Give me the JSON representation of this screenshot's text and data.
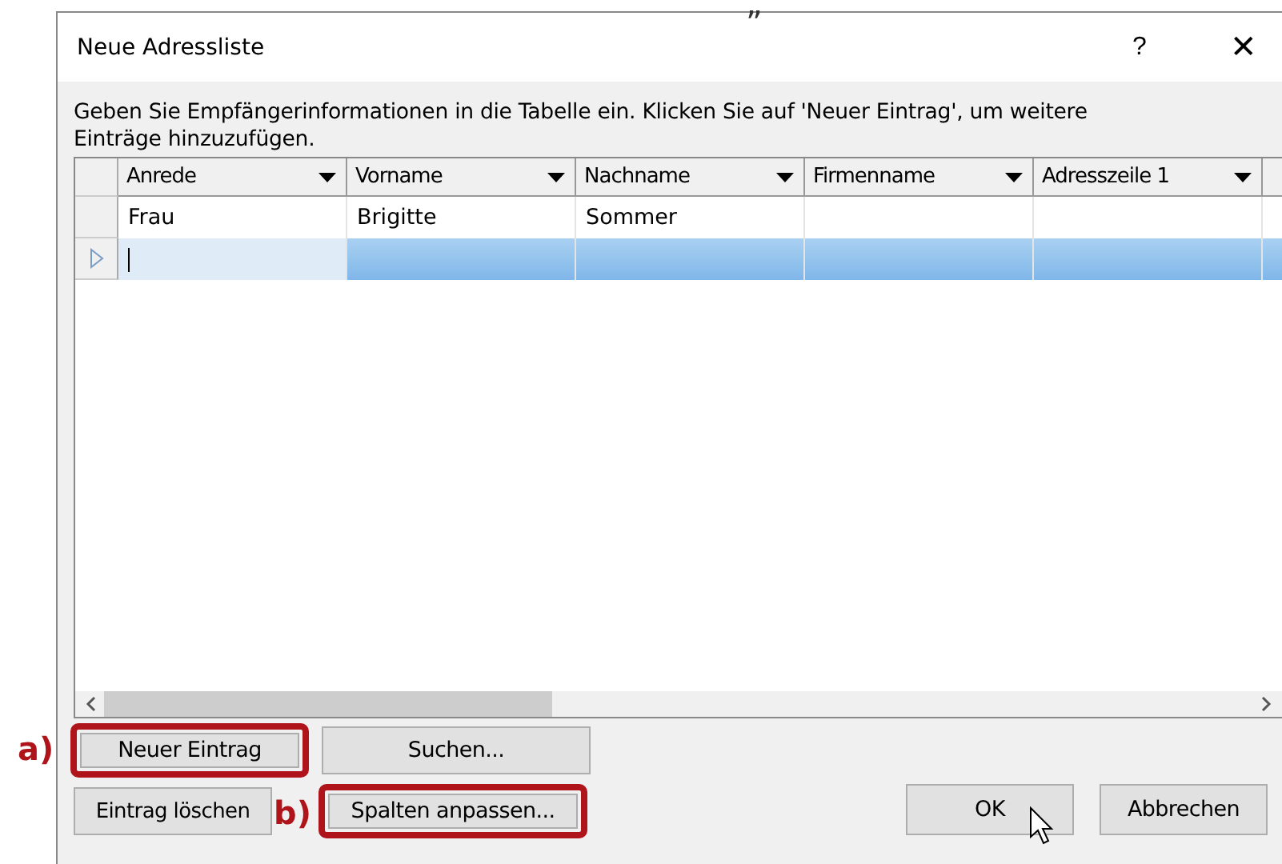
{
  "top_fragment": "„",
  "window": {
    "title": "Neue Adressliste",
    "help": "?",
    "close": "✕"
  },
  "instruction": {
    "text": "Geben Sie Empfängerinformationen in die Tabelle ein. Klicken Sie auf 'Neuer Eintrag', um weitere Einträge hinzuzufügen."
  },
  "table": {
    "columns": [
      "Anrede",
      "Vorname",
      "Nachname",
      "Firmenname",
      "Adresszeile 1"
    ],
    "rows": [
      {
        "selected": false,
        "cells": [
          "Frau",
          "Brigitte",
          "Sommer",
          "",
          ""
        ]
      },
      {
        "selected": true,
        "cells": [
          "",
          "",
          "",
          "",
          ""
        ]
      }
    ]
  },
  "buttons": [
    {
      "label": "Neuer Eintrag",
      "highlighted": true,
      "annotation": "a)"
    },
    {
      "label": "Suchen...",
      "highlighted": false
    },
    {
      "label": "Eintrag löschen",
      "highlighted": false
    },
    {
      "label": "Spalten anpassen...",
      "highlighted": true,
      "annotation": "b)"
    }
  ],
  "dialog_buttons": [
    {
      "label": "OK",
      "pointer": true
    },
    {
      "label": "Abbrechen",
      "pointer": false
    }
  ]
}
